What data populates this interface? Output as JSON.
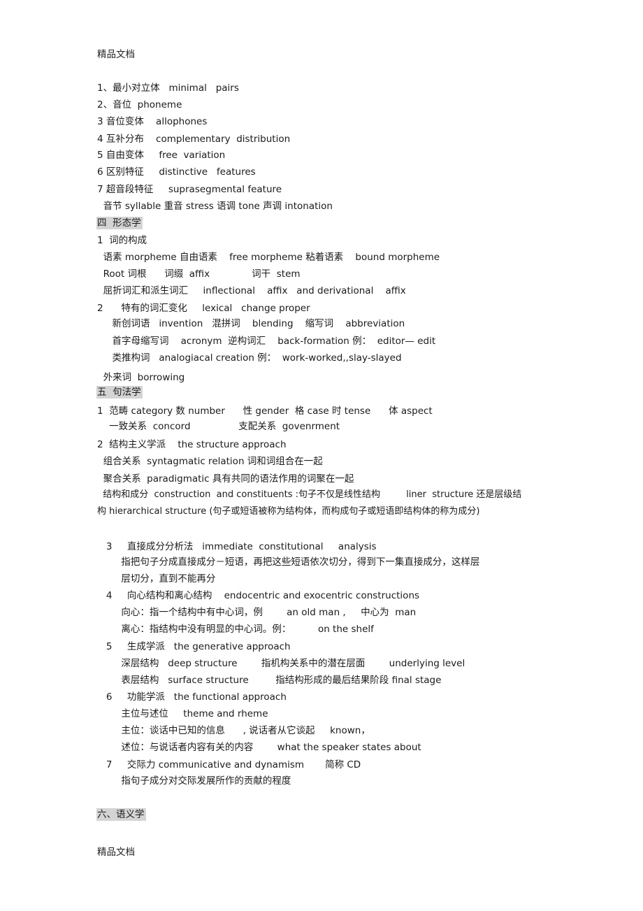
{
  "header": "精品文档",
  "footer": "精品文档",
  "phonology_items": [
    "1、最小对立体   minimal   pairs",
    "2、音位  phoneme",
    "3 音位变体    allophones",
    "4 互补分布    complementary  distribution",
    "5 自由变体     free  variation",
    "6 区别特征     distinctive   features",
    "7 超音段特征     suprasegmental feature",
    "  音节 syllable 重音 stress 语调 tone 声调 intonation"
  ],
  "section4": {
    "title": "四  形态学",
    "lines": [
      "1  词的构成",
      "  语素 morpheme 自由语素    free morpheme 粘着语素    bound morpheme",
      "  Root 词根      词缀  affix              词干  stem",
      "  屈折词汇和派生词汇     inflectional    affix   and derivational    affix",
      "2      特有的词汇变化     lexical   change proper",
      "     新创词语   invention   混拼词    blending    缩写词    abbreviation",
      "     首字母缩写词    acronym  逆构词汇    back-formation 例：  editor— edit",
      "     类推构词   analogiacal creation 例：  work-worked,,slay-slayed",
      "  外来词  borrowing"
    ]
  },
  "section5": {
    "title": "五  句法学",
    "lines": [
      "1  范畴 category 数 number      性 gender  格 case 时 tense      体 aspect",
      "    一致关系  concord                支配关系  govenrment",
      "2  结构主义学派    the structure approach",
      "  组合关系  syntagmatic relation 词和词组合在一起",
      "  聚合关系  paradigmatic 具有共同的语法作用的词聚在一起",
      "  结构和成分  construction  and constituents :句子不仅是线性结构         liner  structure 还是层级结",
      "构 hierarchical structure (句子或短语被称为结构体，而构成句子或短语即结构体的称为成分)",
      "   3     直接成分分析法   immediate  constitutional     analysis",
      "        指把句子分成直接成分－短语，再把这些短语依次切分，得到下一集直接成分，这样层",
      "        层切分，直到不能再分",
      "   4     向心结构和离心结构    endocentric and exocentric constructions",
      "        向心：指一个结构中有中心词，例        an old man ,     中心为  man",
      "        离心：指结构中没有明显的中心词。例：         on the shelf",
      "   5     生成学派   the generative approach",
      "        深层结构   deep structure        指机构关系中的潜在层面        underlying level",
      "        表层结构   surface structure         指结构形成的最后结果阶段 final stage",
      "   6     功能学派   the functional approach",
      "        主位与述位     theme and rheme",
      "        主位：谈话中已知的信息      , 说话者从它谈起     known，",
      "        述位：与说话者内容有关的内容        what the speaker states about",
      "   7     交际力 communicative and dynamism       简称 CD",
      "        指句子成分对交际发展所作的贡献的程度"
    ]
  },
  "section6": {
    "title": "六、语义学"
  }
}
